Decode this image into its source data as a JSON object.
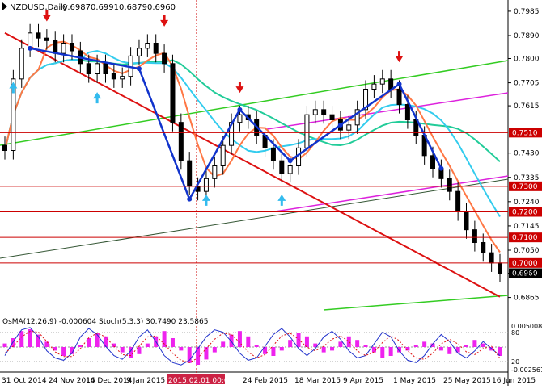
{
  "chart_data": [
    {
      "type": "candlestick",
      "title": "NZDUSD,Daily",
      "ohlc": [
        "0.6987",
        "0.6991",
        "0.6879",
        "0.6960"
      ],
      "ylim": [
        0.681,
        0.801
      ],
      "y_ticks": [
        "0.7985",
        "0.7890",
        "0.7800",
        "0.7705",
        "0.7615",
        "0.7430",
        "0.7335",
        "0.7240",
        "0.7145",
        "0.7050",
        "0.6960",
        "0.6865"
      ],
      "x_ticks": [
        "31 Oct 2014",
        "24 Nov 2014",
        "16 Dec 2014",
        "9 Jan 2015",
        "2015.02.01 00:00",
        "24 Feb 2015",
        "18 Mar 2015",
        "9 Apr 2015",
        "1 May 2015",
        "25 May 2015",
        "16 Jun 2015"
      ],
      "level_labels": [
        {
          "value": 0.751,
          "label": "0.7510",
          "color": "#cc0000"
        },
        {
          "value": 0.73,
          "label": "0.7300",
          "color": "#cc0000"
        },
        {
          "value": 0.72,
          "label": "0.7200",
          "color": "#cc0000"
        },
        {
          "value": 0.71,
          "label": "0.7100",
          "color": "#cc0000"
        },
        {
          "value": 0.7,
          "label": "0.7000",
          "color": "#cc0000"
        },
        {
          "value": 0.696,
          "label": "0.6960",
          "color": "#000000"
        }
      ],
      "horizontal_lines": [
        0.751,
        0.73,
        0.72,
        0.71,
        0.7
      ],
      "vertical_marker_label": "2015.02.01 00:00",
      "closes": [
        0.744,
        0.772,
        0.784,
        0.79,
        0.788,
        0.787,
        0.782,
        0.786,
        0.783,
        0.778,
        0.774,
        0.778,
        0.774,
        0.772,
        0.773,
        0.781,
        0.784,
        0.786,
        0.782,
        0.778,
        0.755,
        0.74,
        0.73,
        0.728,
        0.733,
        0.738,
        0.746,
        0.755,
        0.758,
        0.756,
        0.75,
        0.745,
        0.74,
        0.735,
        0.738,
        0.745,
        0.758,
        0.76,
        0.758,
        0.756,
        0.752,
        0.754,
        0.76,
        0.768,
        0.77,
        0.772,
        0.768,
        0.762,
        0.756,
        0.75,
        0.742,
        0.737,
        0.733,
        0.728,
        0.72,
        0.713,
        0.708,
        0.704,
        0.7,
        0.696
      ],
      "overlays": [
        {
          "name": "MA slow",
          "color": "#dd1111"
        },
        {
          "name": "MA",
          "color": "#22cc99"
        },
        {
          "name": "MA",
          "color": "#33ccee"
        },
        {
          "name": "MA",
          "color": "#ff7744"
        },
        {
          "name": "ZigZag",
          "color": "#1133cc"
        }
      ],
      "trend_channels": [
        {
          "color": "#33cc22"
        },
        {
          "color": "#dd22dd"
        },
        {
          "color": "#335533"
        }
      ]
    },
    {
      "type": "histogram+line",
      "title": "OsMA(12,26,9) -0.000604 Stoch(5,3,3) 30.7490 23.5865",
      "y_ticks": [
        "0.005008",
        "80",
        "20",
        "-0.002561"
      ],
      "hist": [
        0.2,
        0.5,
        0.9,
        1.0,
        0.7,
        0.3,
        -0.2,
        -0.5,
        -0.4,
        0.1,
        0.5,
        0.8,
        0.6,
        0.2,
        -0.3,
        -0.6,
        -0.4,
        0.2,
        0.6,
        0.9,
        0.5,
        -0.2,
        -0.9,
        -1.0,
        -0.7,
        -0.3,
        0.3,
        0.7,
        0.9,
        0.6,
        0.1,
        -0.4,
        -0.5,
        -0.2,
        0.4,
        0.8,
        0.6,
        0.2,
        -0.3,
        -0.2,
        0.3,
        0.6,
        0.4,
        0.1,
        -0.3,
        -0.6,
        -0.5,
        -0.3,
        -0.2,
        0.1,
        0.3,
        0.2,
        -0.2,
        -0.4,
        -0.3,
        0.1,
        0.4,
        0.2,
        -0.2,
        -0.5
      ],
      "stoch_k": [
        30,
        60,
        85,
        90,
        70,
        40,
        25,
        20,
        35,
        70,
        88,
        75,
        50,
        30,
        22,
        40,
        70,
        85,
        60,
        30,
        15,
        10,
        20,
        45,
        70,
        85,
        80,
        60,
        35,
        20,
        25,
        50,
        75,
        88,
        70,
        45,
        30,
        45,
        70,
        82,
        65,
        40,
        25,
        30,
        55,
        80,
        70,
        40,
        20,
        15,
        30,
        55,
        75,
        60,
        35,
        25,
        40,
        60,
        45,
        30
      ],
      "stoch_d": [
        35,
        50,
        70,
        82,
        80,
        60,
        38,
        28,
        28,
        45,
        68,
        78,
        70,
        50,
        32,
        30,
        50,
        70,
        72,
        55,
        35,
        20,
        15,
        25,
        45,
        65,
        78,
        75,
        58,
        38,
        25,
        32,
        52,
        72,
        78,
        65,
        48,
        40,
        50,
        65,
        72,
        60,
        40,
        30,
        38,
        58,
        72,
        62,
        40,
        25,
        22,
        35,
        55,
        65,
        55,
        38,
        32,
        45,
        50,
        24
      ]
    }
  ]
}
